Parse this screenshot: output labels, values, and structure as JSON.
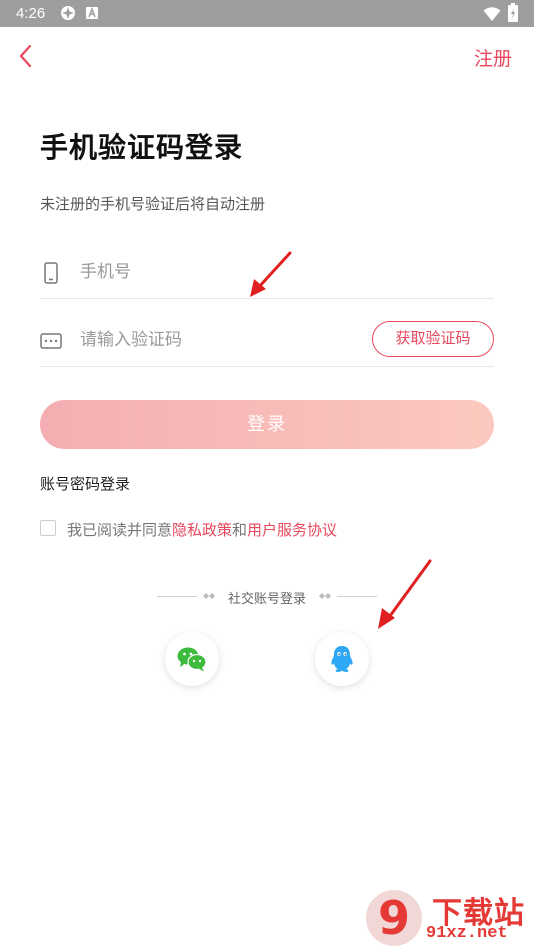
{
  "status_bar": {
    "time": "4:26",
    "icons": [
      "app-icon",
      "a-icon",
      "wifi-icon",
      "battery-icon"
    ]
  },
  "header": {
    "back_icon": "chevron-left-icon",
    "register_label": "注册"
  },
  "title": "手机验证码登录",
  "subtitle": "未注册的手机号验证后将自动注册",
  "phone_field": {
    "icon": "phone-icon",
    "placeholder": "手机号",
    "value": ""
  },
  "code_field": {
    "icon": "keyboard-icon",
    "placeholder": "请输入验证码",
    "value": "",
    "get_code_label": "获取验证码"
  },
  "login_button_label": "登录",
  "password_login_label": "账号密码登录",
  "agreement": {
    "checked": false,
    "prefix": "我已阅读并同意",
    "privacy_link": "隐私政策",
    "conjunction": "和",
    "terms_link": "用户服务协议"
  },
  "social_login": {
    "label": "社交账号登录",
    "providers": [
      {
        "name": "wechat",
        "icon": "wechat-icon"
      },
      {
        "name": "qq",
        "icon": "qq-icon"
      }
    ]
  },
  "annotations": {
    "arrow_color": "#e02020"
  },
  "watermark": {
    "title": "下载站",
    "url": "91xz.net",
    "logo_text": "9"
  },
  "colors": {
    "accent": "#e8485c",
    "login_gradient_start": "#f4aeb2",
    "login_gradient_end": "#fbc9bf",
    "status_bar": "#9e9e9e"
  }
}
